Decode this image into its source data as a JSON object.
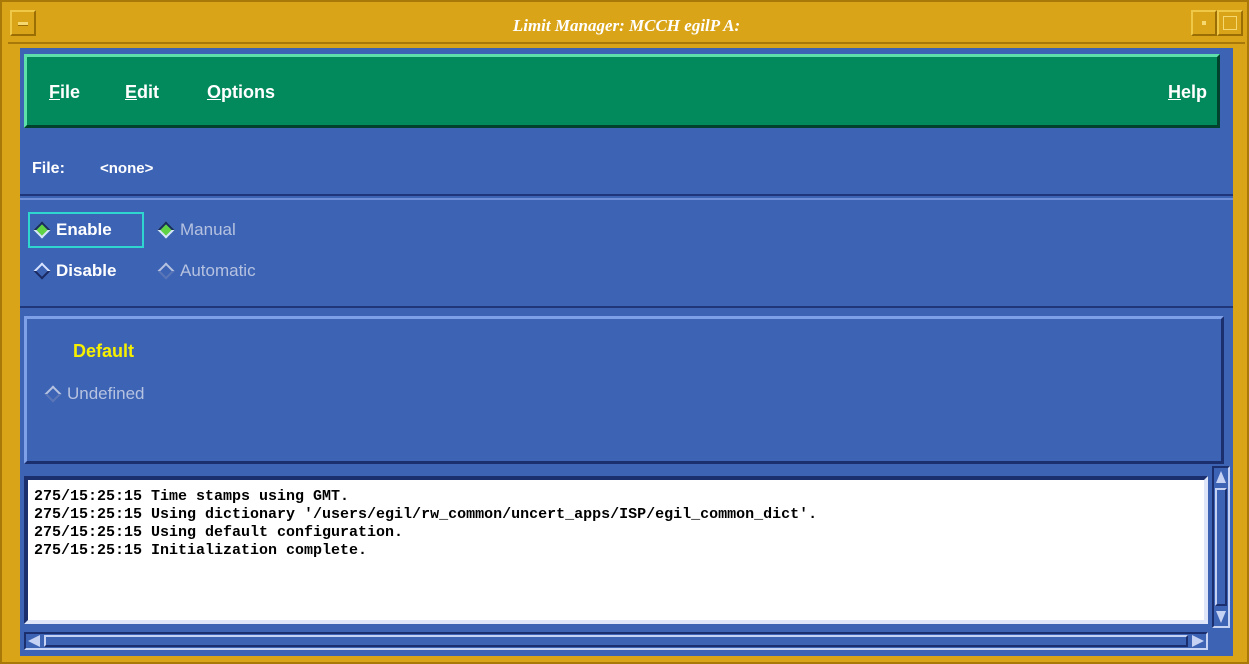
{
  "window": {
    "title": "Limit Manager: MCCH egilP A:"
  },
  "menubar": {
    "file": {
      "mnemonic": "F",
      "rest": "ile"
    },
    "edit": {
      "mnemonic": "E",
      "rest": "dit"
    },
    "options": {
      "mnemonic": "O",
      "rest": "ptions"
    },
    "help": {
      "mnemonic": "H",
      "rest": "elp"
    }
  },
  "file_row": {
    "label": "File:",
    "value": "<none>"
  },
  "mode": {
    "enable": {
      "label": "Enable",
      "selected": true
    },
    "disable": {
      "label": "Disable",
      "selected": false
    },
    "manual": {
      "label": "Manual",
      "selected": true,
      "enabled": false
    },
    "automatic": {
      "label": "Automatic",
      "selected": false,
      "enabled": false
    }
  },
  "default_panel": {
    "title": "Default",
    "undefined_label": "Undefined"
  },
  "log": {
    "lines": [
      "275/15:25:15 Time stamps using GMT.",
      "275/15:25:15 Using dictionary '/users/egil/rw_common/uncert_apps/ISP/egil_common_dict'.",
      "275/15:25:15 Using default configuration.",
      "275/15:25:15 Initialization complete."
    ]
  },
  "colors": {
    "window_frame": "#d9a418",
    "menubar": "#038a5c",
    "panel": "#3d63b5",
    "default_title": "#f6f000",
    "focus_ring": "#2fd6d0",
    "radio_on": "#5fd246"
  }
}
